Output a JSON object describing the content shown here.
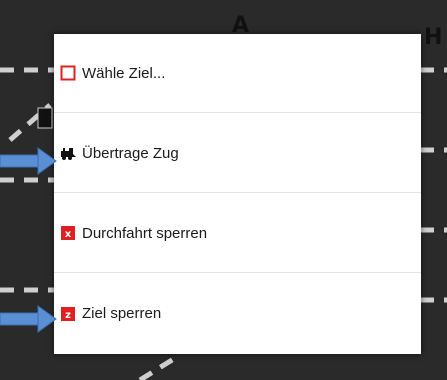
{
  "background": {
    "color": "#2a2a2a",
    "track_color": "#cfcfcf",
    "letter_a": "A",
    "letter_h": "H"
  },
  "menu": {
    "items": [
      {
        "label": "Wähle Ziel...",
        "icon": "square-outline-icon"
      },
      {
        "label": "Übertrage Zug",
        "icon": "train-icon"
      },
      {
        "label": "Durchfahrt sperren",
        "icon": "red-x-block-icon"
      },
      {
        "label": "Ziel sperren",
        "icon": "red-z-block-icon"
      }
    ]
  },
  "icon_text": {
    "block_x": "x",
    "block_z": "z"
  },
  "annotations": {
    "arrow_color": "#5b8fd4",
    "pointed_items": [
      "Übertrage Zug",
      "Ziel sperren"
    ]
  },
  "colors": {
    "accent_red": "#e02020",
    "menu_background": "#ffffff",
    "divider": "#e3e3e3"
  }
}
